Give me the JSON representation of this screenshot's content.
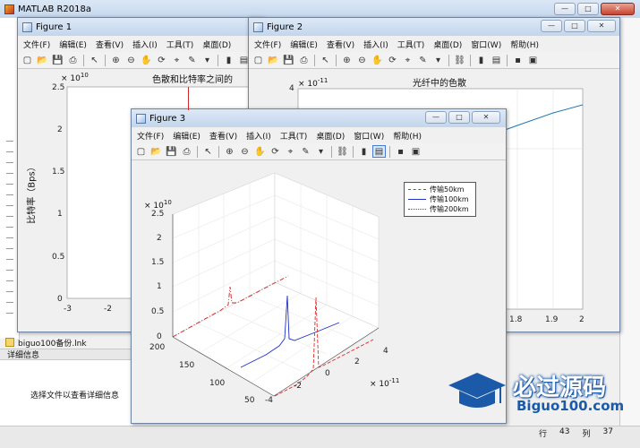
{
  "main_window": {
    "title": "MATLAB R2018a"
  },
  "left_panel": {
    "file_item": "biguo100备份.lnk",
    "details_header": "详细信息",
    "details_placeholder": "选择文件以查看详细信息"
  },
  "status_bar": {
    "row_label": "行",
    "row_value": "43",
    "col_label": "列",
    "col_value": "37"
  },
  "menu": [
    "文件(F)",
    "编辑(E)",
    "查看(V)",
    "插入(I)",
    "工具(T)",
    "桌面(D)",
    "窗口(W)",
    "帮助(H)"
  ],
  "figure1": {
    "title": "Figure 1",
    "menu_visible": [
      "文件(F)",
      "编辑(E)",
      "查看(V)",
      "插入(I)",
      "工具(T)",
      "桌面(D)"
    ],
    "axes_title": "色散和比特率之间的",
    "ylabel": "比特率（Bps）",
    "y_exponent": "× 10",
    "y_exponent_power": "10",
    "yticks": [
      "2.5",
      "2",
      "1.5",
      "1",
      "0.5",
      "0"
    ],
    "xticks": [
      "-3",
      "-2"
    ]
  },
  "figure2": {
    "title": "Figure 2",
    "axes_title": "光纤中的色散",
    "y_exponent": "× 10",
    "y_exponent_power": "-11",
    "yticks_visible": [
      "4"
    ],
    "xticks_visible": [
      "1.8",
      "1.9",
      "2"
    ]
  },
  "figure3": {
    "title": "Figure 3",
    "z_exponent": "× 10",
    "z_exponent_power": "10",
    "x_exponent": "× 10",
    "x_exponent_power": "-11",
    "zticks": [
      "2.5",
      "2",
      "1.5",
      "1",
      "0.5",
      "0"
    ],
    "yticks": [
      "200",
      "150",
      "100",
      "50"
    ],
    "xticks": [
      "-4",
      "-2",
      "0",
      "2",
      "4"
    ],
    "legend": [
      {
        "label": "传输50km",
        "color": "#e0282b",
        "style": "dashed"
      },
      {
        "label": "传输100km",
        "color": "#2030c8",
        "style": "solid"
      },
      {
        "label": "传输200km",
        "color": "#d02020",
        "style": "dashdot"
      }
    ]
  },
  "watermark": {
    "brand": "必过源码",
    "site": "Biguo100.com"
  },
  "colors": {
    "accent_blue": "#1a5aa8",
    "window_border": "#6f86a3"
  }
}
